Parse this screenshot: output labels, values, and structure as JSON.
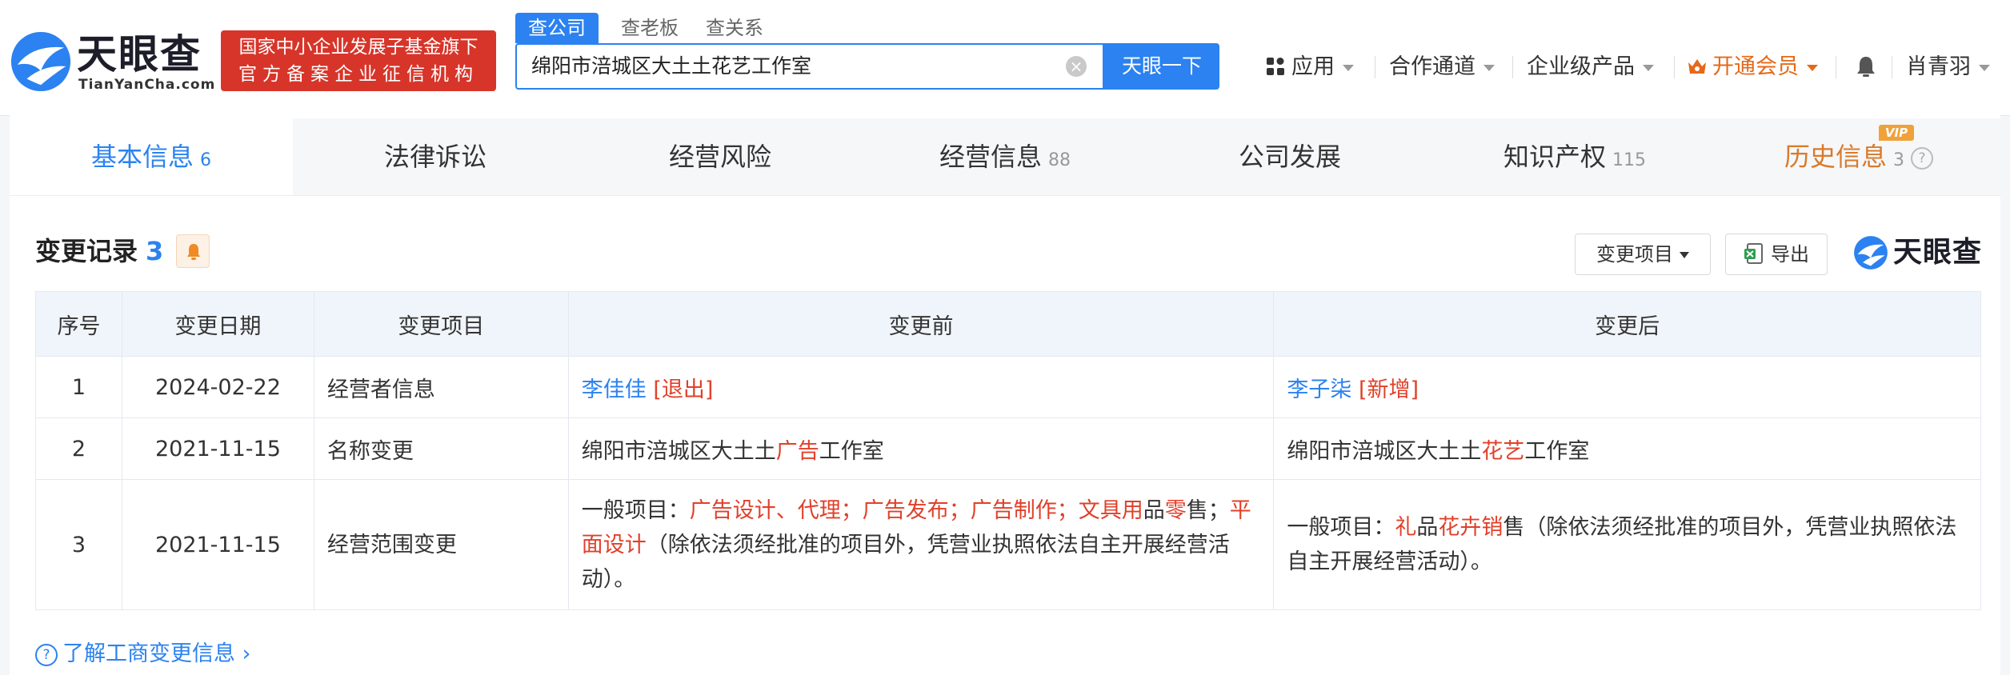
{
  "header": {
    "logo_text": "天眼查",
    "logo_sub": "TianYanCha.com",
    "banner_line1": "国家中小企业发展子基金旗下",
    "banner_line2": "官方备案企业征信机构",
    "search_tabs": [
      "查公司",
      "查老板",
      "查关系"
    ],
    "search_value": "绵阳市涪城区大土土花艺工作室",
    "search_button": "天眼一下",
    "nav": {
      "apps": "应用",
      "cooperation": "合作通道",
      "enterprise": "企业级产品",
      "vip": "开通会员",
      "user": "肖青羽"
    },
    "accent_color": "#2b82f0",
    "banner_color": "#d7352a"
  },
  "tabs": [
    {
      "label": "基本信息",
      "count": "6"
    },
    {
      "label": "法律诉讼",
      "count": ""
    },
    {
      "label": "经营风险",
      "count": ""
    },
    {
      "label": "经营信息",
      "count": "88"
    },
    {
      "label": "公司发展",
      "count": ""
    },
    {
      "label": "知识产权",
      "count": "115"
    },
    {
      "label": "历史信息",
      "count": "3",
      "badge": "VIP"
    }
  ],
  "section": {
    "title": "变更记录",
    "count": "3",
    "filter_button": "变更项目",
    "export_button": "导出",
    "brand": "天眼查"
  },
  "table": {
    "headers": [
      "序号",
      "变更日期",
      "变更项目",
      "变更前",
      "变更后"
    ],
    "rows": [
      {
        "index": "1",
        "date": "2024-02-22",
        "item": "经营者信息",
        "before": {
          "name": "李佳佳",
          "tag": "[退出]"
        },
        "after": {
          "name": "李子柒",
          "tag": "[新增]"
        }
      },
      {
        "index": "2",
        "date": "2021-11-15",
        "item": "名称变更",
        "before": {
          "pre": "绵阳市涪城区大土土",
          "hl": "广告",
          "post": "工作室"
        },
        "after": {
          "pre": "绵阳市涪城区大土土",
          "hl": "花艺",
          "post": "工作室"
        }
      },
      {
        "index": "3",
        "date": "2021-11-15",
        "item": "经营范围变更",
        "before": {
          "p1": "一般项目：",
          "h1": "广告设计、代理；广告发布；广告制作；文具用",
          "p2": "品",
          "h2": "零",
          "p3": "售；",
          "h3": "平面设计",
          "p4": "（除依法须经批准的项目外，凭营业执照依法自主开展经营活动）。"
        },
        "after": {
          "p1": "一般项目：",
          "h1": "礼",
          "p2": "品",
          "h2": "花卉销",
          "p3": "售（除依法须经批准的项目外，凭营业执照依法自主开展经营活动）。"
        }
      }
    ]
  },
  "footer_link": "了解工商变更信息"
}
